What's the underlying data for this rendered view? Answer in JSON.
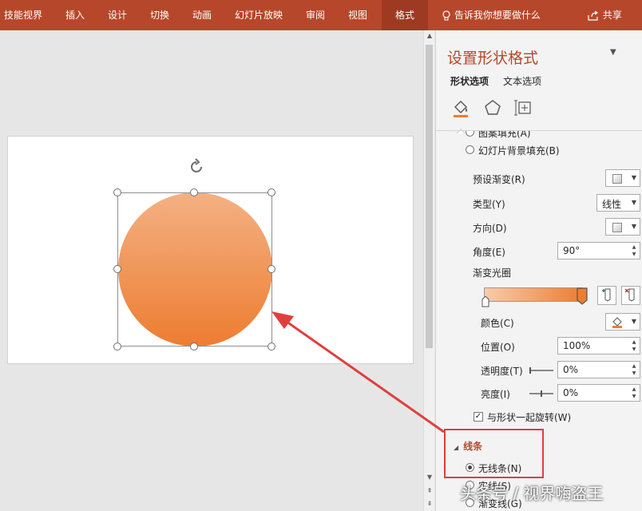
{
  "ribbon": {
    "tabs": [
      {
        "label": "技能视界"
      },
      {
        "label": "插入"
      },
      {
        "label": "设计"
      },
      {
        "label": "切换"
      },
      {
        "label": "动画"
      },
      {
        "label": "幻灯片放映"
      },
      {
        "label": "审阅"
      },
      {
        "label": "视图"
      },
      {
        "label": "格式"
      }
    ],
    "active_tab": "格式",
    "tellme": "告诉我你想要做什么",
    "share": "共享",
    "color": "#b7472a"
  },
  "shape": {
    "gradient_top": "#f4b183",
    "gradient_bottom": "#ed7d31"
  },
  "pane": {
    "title": "设置形状格式",
    "tabs": [
      "形状选项",
      "文本选项"
    ],
    "icons": [
      "fill-line-icon",
      "effects-pentagon-icon",
      "size-properties-icon"
    ],
    "partial_top": "图案填充(A)",
    "slide_bg": "幻灯片背景填充(B)",
    "preset_label": "预设渐变(R)",
    "type_label": "类型(Y)",
    "type_value": "线性",
    "direction_label": "方向(D)",
    "angle_label": "角度(E)",
    "angle_value": "90°",
    "stops_label": "渐变光圈",
    "color_label": "颜色(C)",
    "position_label": "位置(O)",
    "position_value": "100%",
    "transparency_label": "透明度(T)",
    "transparency_value": "0%",
    "brightness_label": "亮度(I)",
    "brightness_value": "0%",
    "rotate_label": "与形状一起旋转(W)",
    "line_section": "线条",
    "no_line": "无线条(N)",
    "solid_line": "实线(S)",
    "gradient_line": "渐变线(G)"
  },
  "watermark": "头条号 / 视界嗨盗王",
  "colors": {
    "annotation_red": "#e03e3e",
    "accent": "#b7472a"
  }
}
